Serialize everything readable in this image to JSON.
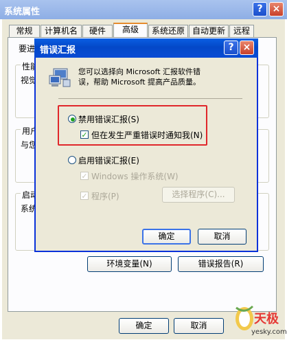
{
  "outer": {
    "title": "系统属性",
    "help_btn": "?",
    "close_btn": "×",
    "tabs": [
      "常规",
      "计算机名",
      "硬件",
      "高级",
      "系统还原",
      "自动更新",
      "远程"
    ],
    "partial_labels": [
      "要进",
      "性能",
      "视觉",
      "用户",
      "与您",
      "启动",
      "系统"
    ],
    "env_button": "环境变量(N)",
    "error_report_button": "错误报告(R)",
    "ok": "确定",
    "cancel": "取消"
  },
  "dialog": {
    "title": "错误汇报",
    "help_btn": "?",
    "close_btn": "×",
    "description": "您可以选择向 Microsoft 汇报软件错误，帮助 Microsoft 提高产品质量。",
    "option_disable": "禁用错误汇报(S)",
    "notify_critical": "但在发生严重错误时通知我(N)",
    "option_enable": "启用错误汇报(E)",
    "windows_os": "Windows 操作系统(W)",
    "programs": "程序(P)",
    "choose_programs": "选择程序(C)...",
    "ok": "确定",
    "cancel": "取消"
  },
  "watermark": {
    "site": "yesky.com"
  }
}
